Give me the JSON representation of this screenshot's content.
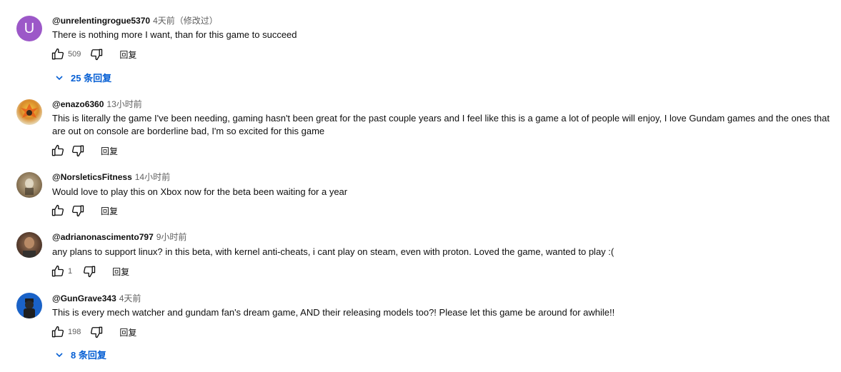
{
  "comments": [
    {
      "author": "@unrelentingrogue5370",
      "time": "4天前（修改过）",
      "text": "There is nothing more I want, than for this game to succeed",
      "likes": "509",
      "reply_label": "回复",
      "replies_label": "25 条回复",
      "avatar_letter": "U"
    },
    {
      "author": "@enazo6360",
      "time": "13小时前",
      "text": "This is literally the game I've been needing, gaming hasn't been great for the past couple years and I feel like this is a game a lot of people will enjoy, I love Gundam games and the ones that are out on console are borderline bad, I'm so excited for this game",
      "likes": "",
      "reply_label": "回复"
    },
    {
      "author": "@NorsleticsFitness",
      "time": "14小时前",
      "text": "Would love to play this on Xbox now for the beta been waiting for a year",
      "likes": "",
      "reply_label": "回复"
    },
    {
      "author": "@adrianonascimento797",
      "time": "9小时前",
      "text": "any plans to support linux? in this beta, with kernel anti-cheats, i cant play on steam, even with proton. Loved the game, wanted to play :(",
      "likes": "1",
      "reply_label": "回复"
    },
    {
      "author": "@GunGrave343",
      "time": "4天前",
      "text": "This is every mech watcher and gundam fan's dream game, AND their releasing models too?! Please let this game be around for awhile!!",
      "likes": "198",
      "reply_label": "回复",
      "replies_label": "8 条回复"
    }
  ]
}
